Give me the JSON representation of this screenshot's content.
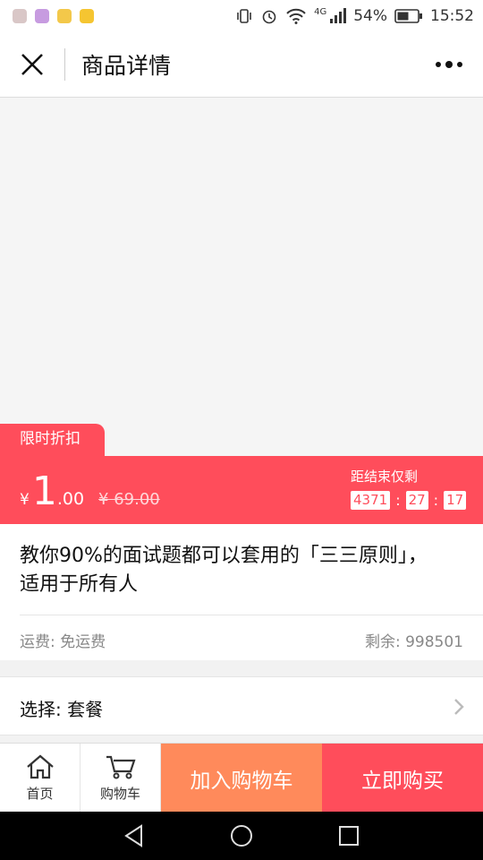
{
  "status_bar": {
    "network": "4G",
    "battery": "54%",
    "time": "15:52"
  },
  "nav": {
    "title": "商品详情"
  },
  "discount": {
    "tag": "限时折扣",
    "currency": "¥",
    "price_int": "1",
    "price_dec": ".00",
    "original_price": "¥ 69.00",
    "countdown_label": "距结束仅剩",
    "countdown": {
      "hours": "4371",
      "minutes": "27",
      "seconds": "17",
      "sep": ":"
    }
  },
  "product": {
    "title": "教你90%的面试题都可以套用的「三三原则」，适用于所有人",
    "shipping": "运费: 免运费",
    "stock": "剩余: 998501"
  },
  "option": {
    "label": "选择: 套餐"
  },
  "bottom": {
    "home_label": "首页",
    "cart_label": "购物车",
    "add_cart": "加入购物车",
    "buy_now": "立即购买"
  },
  "colors": {
    "accent_red": "#ff4d5b",
    "accent_orange": "#ff8a5b"
  },
  "icons": [
    "close-icon",
    "more-icon",
    "home-icon",
    "cart-icon",
    "chevron-right-icon",
    "back-icon",
    "home-circle-icon",
    "recents-icon"
  ]
}
